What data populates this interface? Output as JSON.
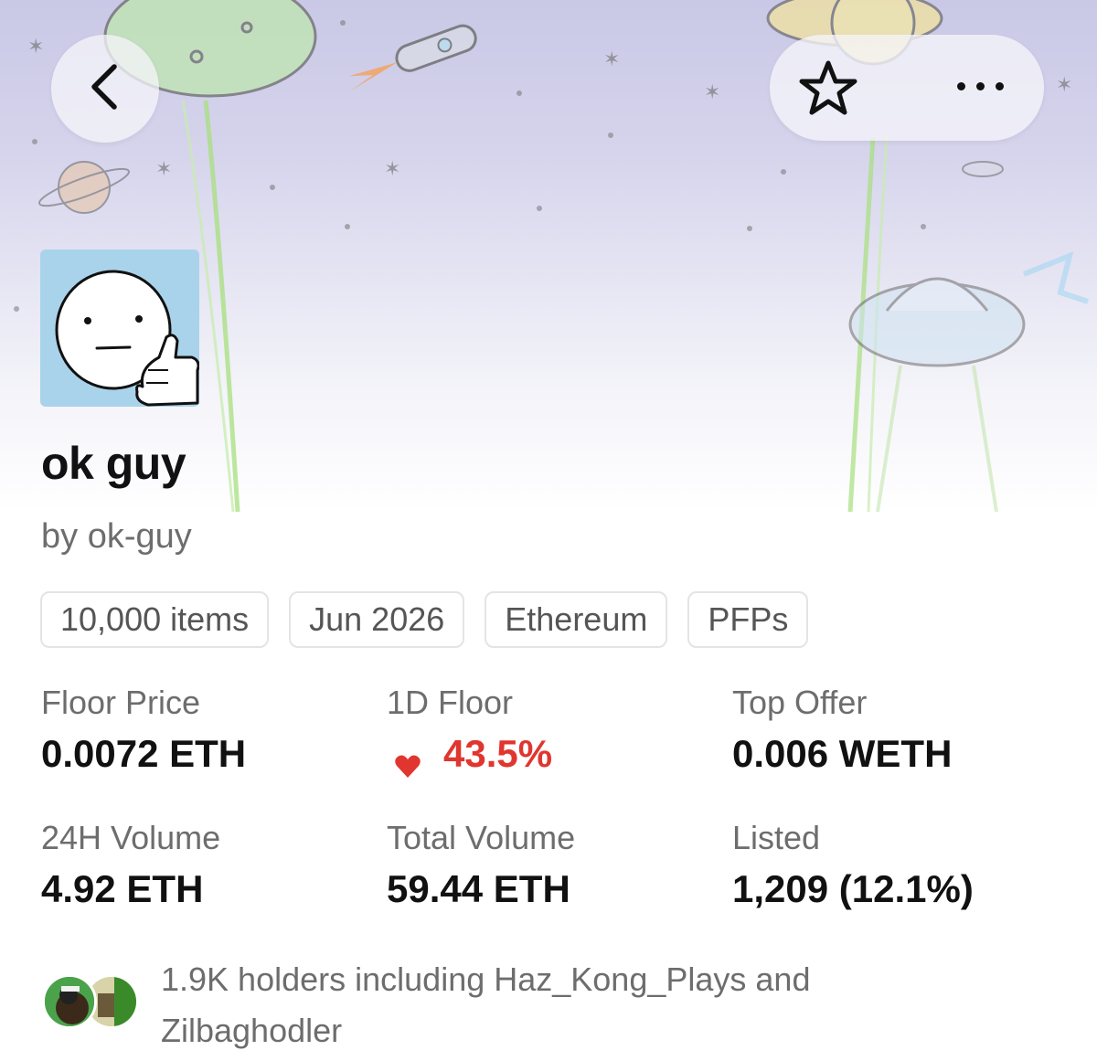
{
  "collection": {
    "name": "ok guy",
    "creator": "by ok-guy"
  },
  "tags": [
    "10,000 items",
    "Jun 2026",
    "Ethereum",
    "PFPs"
  ],
  "stats": {
    "floor_price": {
      "label": "Floor Price",
      "value": "0.0072 ETH"
    },
    "one_day_floor": {
      "label": "1D Floor",
      "value": "43.5%",
      "direction": "down"
    },
    "top_offer": {
      "label": "Top Offer",
      "value": "0.006 WETH"
    },
    "volume_24h": {
      "label": "24H Volume",
      "value": "4.92 ETH"
    },
    "total_volume": {
      "label": "Total Volume",
      "value": "59.44 ETH"
    },
    "listed": {
      "label": "Listed",
      "value": "1,209 (12.1%)"
    }
  },
  "holders": {
    "text": "1.9K holders including Haz_Kong_Plays and Zilbaghodler"
  },
  "icons": {
    "back": "chevron-left-icon",
    "favorite": "star-outline-icon",
    "more": "more-horizontal-icon",
    "trend": "heart-down-icon"
  },
  "colors": {
    "negative": "#e0362f",
    "secondary_text": "#6d6d6d",
    "avatar_bg": "#a9d3ea"
  }
}
